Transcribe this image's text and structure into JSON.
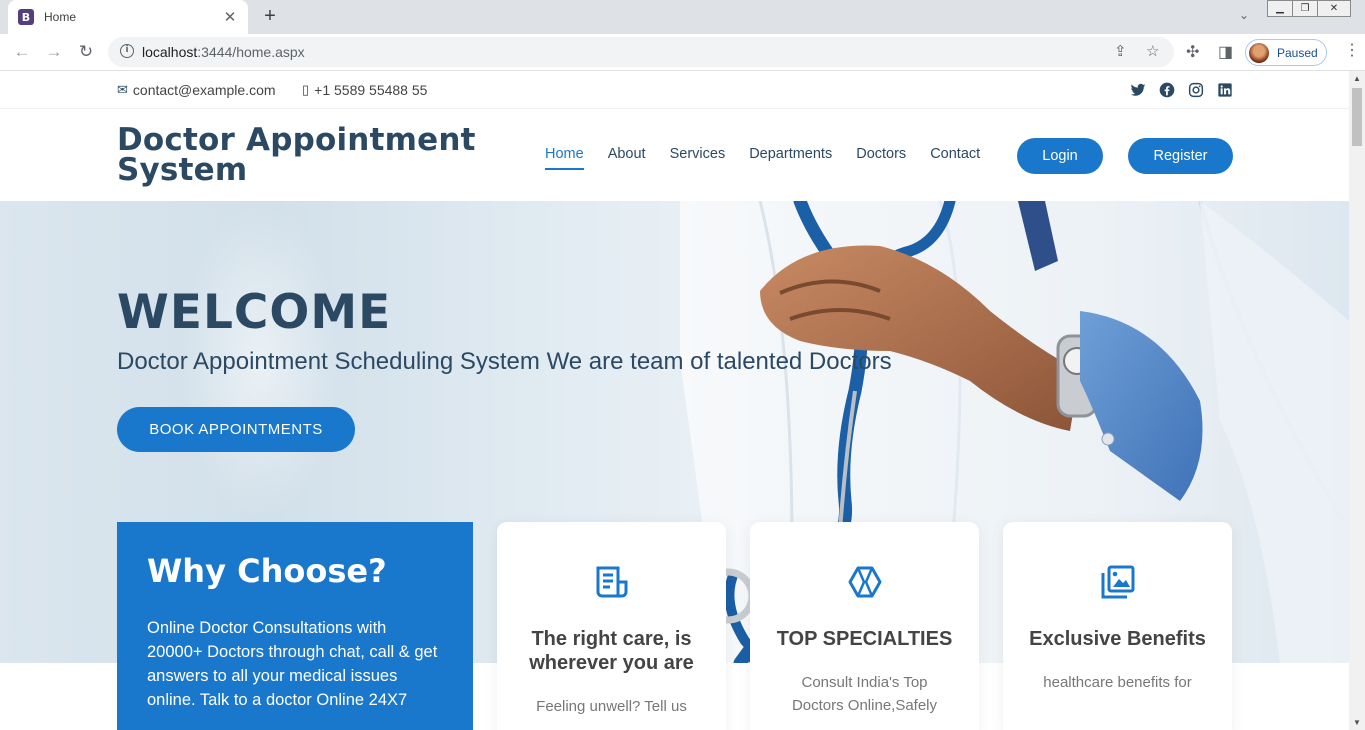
{
  "browser": {
    "tab_favicon": "B",
    "tab_title": "Home",
    "url_host": "localhost",
    "url_rest": ":3444/home.aspx",
    "profile_status": "Paused"
  },
  "topbar": {
    "email": "contact@example.com",
    "phone": "+1 5589 55488 55",
    "social_icons": [
      "twitter-icon",
      "facebook-icon",
      "instagram-icon",
      "linkedin-icon"
    ]
  },
  "header": {
    "brand_line1": "Doctor Appointment",
    "brand_line2": "System",
    "nav": [
      "Home",
      "About",
      "Services",
      "Departments",
      "Doctors",
      "Contact"
    ],
    "active_nav": "Home",
    "login_label": "Login",
    "register_label": "Register"
  },
  "hero": {
    "title": "WELCOME",
    "subtitle": "Doctor Appointment Scheduling System We are team of talented Doctors",
    "cta_label": "BOOK APPOINTMENTS"
  },
  "why": {
    "title": "Why Choose?",
    "text": "Online Doctor Consultations with 20000+ Doctors through chat, call & get answers to all your medical issues online. Talk to a doctor Online 24X7"
  },
  "cards": [
    {
      "icon": "receipt-icon",
      "title": "The right care, is wherever you are",
      "text": "Feeling unwell? Tell us"
    },
    {
      "icon": "cube-icon",
      "title": "TOP SPECIALTIES",
      "text": "Consult India's Top Doctors Online,Safely"
    },
    {
      "icon": "images-icon",
      "title": "Exclusive Benefits",
      "text": "healthcare benefits for"
    }
  ],
  "colors": {
    "primary": "#1977cc",
    "heading": "#2c4964"
  }
}
